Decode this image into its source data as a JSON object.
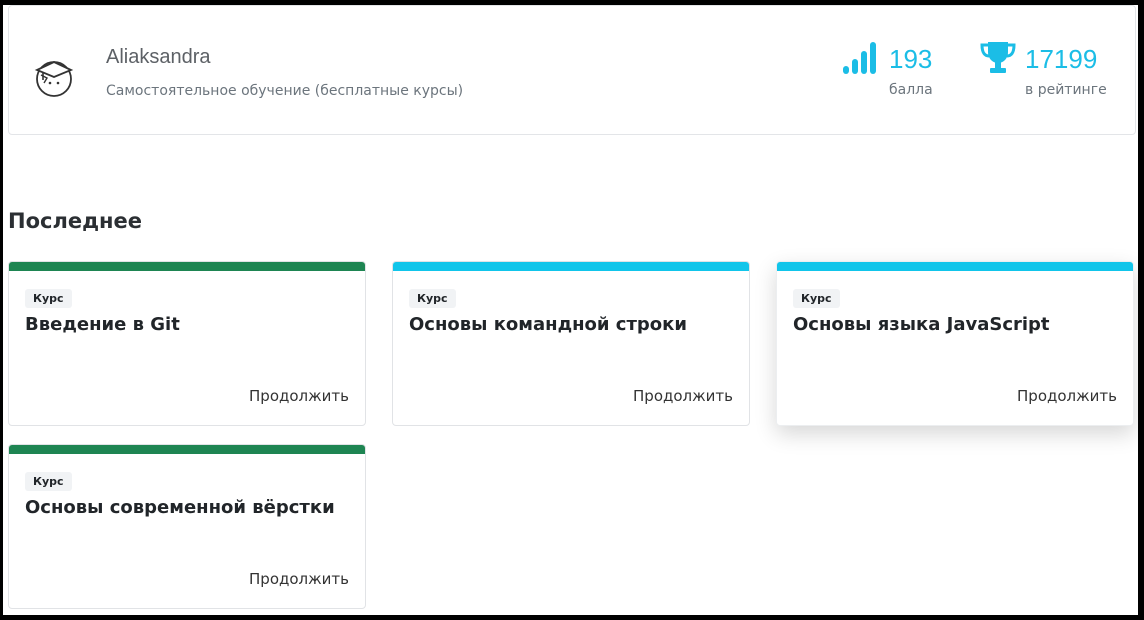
{
  "profile": {
    "name": "Aliaksandra",
    "plan": "Самостоятельное обучение (бесплатные курсы)",
    "points": {
      "value": "193",
      "caption": "балла"
    },
    "rating": {
      "value": "17199",
      "caption": "в рейтинге"
    }
  },
  "colors": {
    "accent": "#1bbde6",
    "green": "#1e8552",
    "cyan": "#11c5ea"
  },
  "section": {
    "title": "Последнее"
  },
  "cards": [
    {
      "badge": "Курс",
      "title": "Введение в Git",
      "action": "Продолжить",
      "bar_color": "#1e8552"
    },
    {
      "badge": "Курс",
      "title": "Основы командной строки",
      "action": "Продолжить",
      "bar_color": "#11c5ea"
    },
    {
      "badge": "Курс",
      "title": "Основы языка JavaScript",
      "action": "Продолжить",
      "bar_color": "#11c5ea"
    },
    {
      "badge": "Курс",
      "title": "Основы современной вёрстки",
      "action": "Продолжить",
      "bar_color": "#1e8552"
    }
  ],
  "icons": {
    "avatar": "student-cap-avatar-icon",
    "points": "signal-bars-icon",
    "rating": "trophy-icon"
  }
}
